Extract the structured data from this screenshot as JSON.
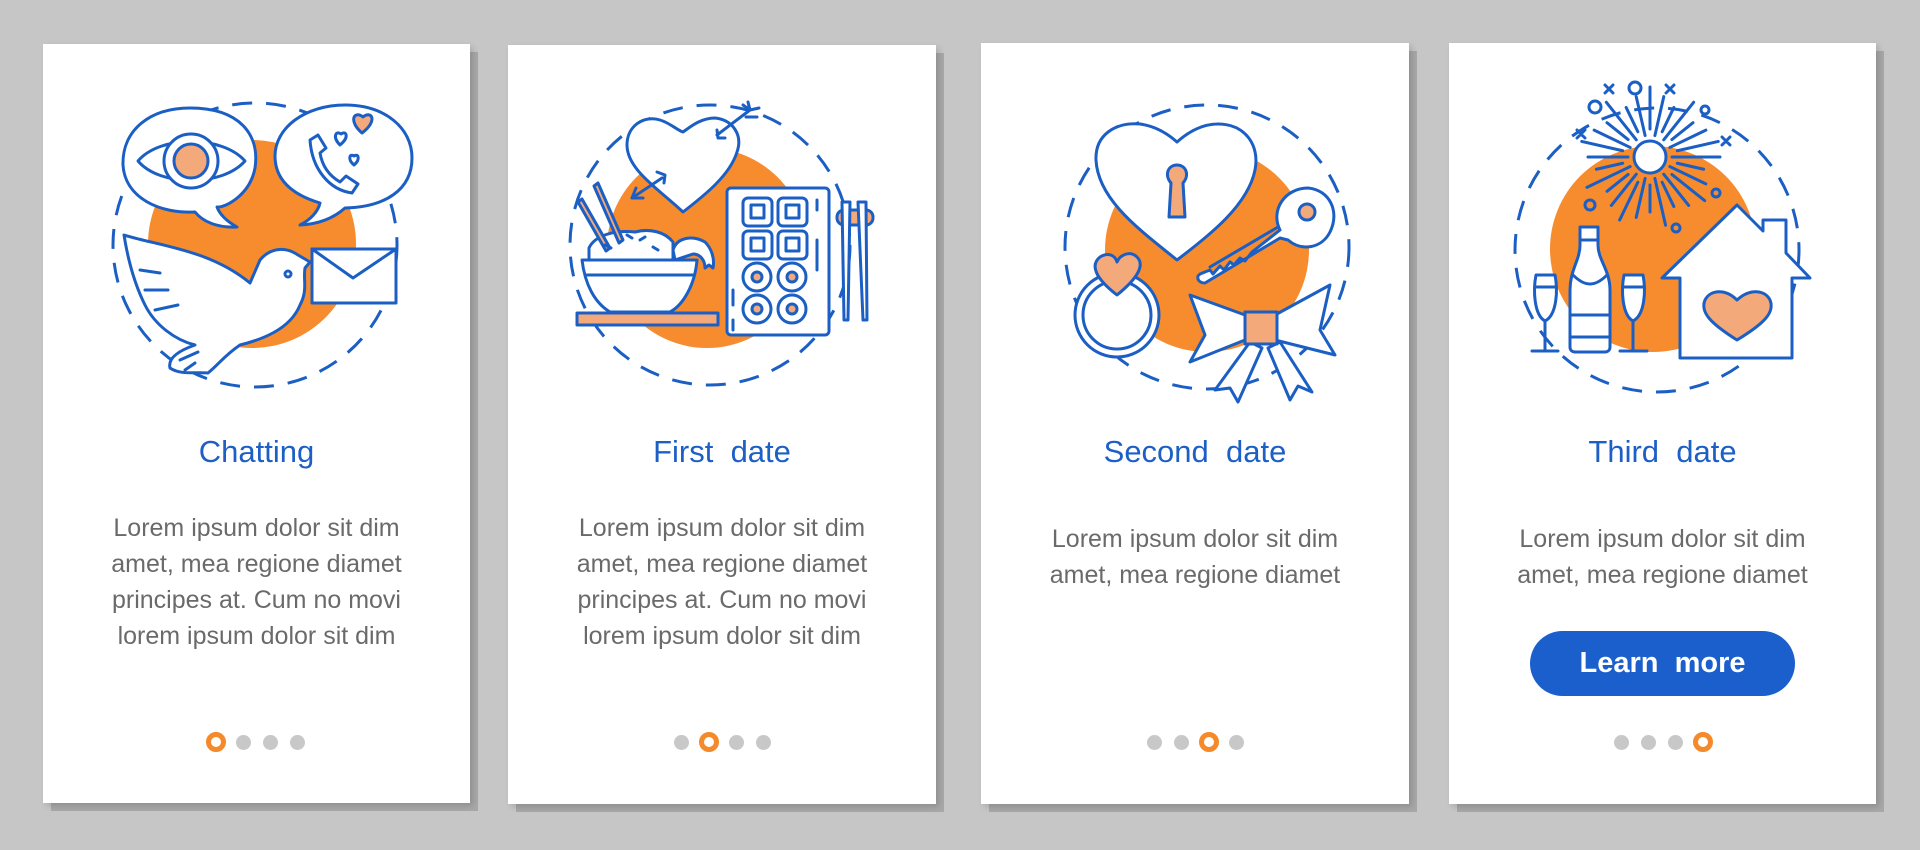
{
  "theme": {
    "background": "#c6c6c6",
    "card_background": "#ffffff",
    "accent_blue": "#1b5fc4",
    "accent_orange": "#f68c2e",
    "accent_peach": "#f4a97a",
    "dot_inactive": "#c8c8c8",
    "text_gray": "#6a6a6a"
  },
  "screens": [
    {
      "title": "Chatting",
      "illustration": "chatting-illustration",
      "body_lines": [
        "Lorem ipsum dolor sit dim",
        "amet, mea regione diamet",
        "principes at. Cum no movi",
        "lorem ipsum dolor sit dim"
      ],
      "pagination": {
        "total": 4,
        "active": 1
      }
    },
    {
      "title": "First  date",
      "illustration": "first-date-illustration",
      "body_lines": [
        "Lorem ipsum dolor sit dim",
        "amet, mea regione diamet",
        "principes at. Cum no movi",
        "lorem ipsum dolor sit dim"
      ],
      "pagination": {
        "total": 4,
        "active": 2
      }
    },
    {
      "title": "Second  date",
      "illustration": "second-date-illustration",
      "body_lines": [
        "Lorem ipsum dolor sit dim",
        "amet, mea regione diamet"
      ],
      "pagination": {
        "total": 4,
        "active": 3
      }
    },
    {
      "title": "Third  date",
      "illustration": "third-date-illustration",
      "body_lines": [
        "Lorem ipsum dolor sit dim",
        "amet, mea regione diamet"
      ],
      "button": {
        "label": "Learn  more"
      },
      "pagination": {
        "total": 4,
        "active": 4
      }
    }
  ]
}
